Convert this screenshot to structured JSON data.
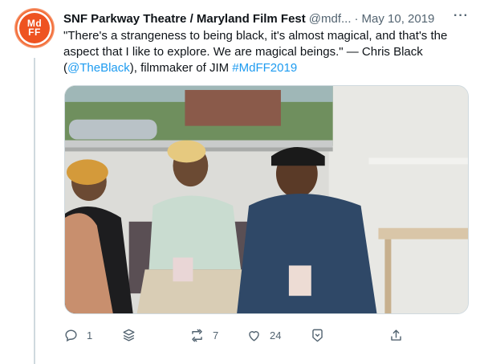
{
  "tweet": {
    "avatar_text_top": "Md",
    "avatar_text_bottom": "FF",
    "author_name": "SNF Parkway Theatre / Maryland Film Fest",
    "handle": "@mdf...",
    "separator": "·",
    "date": "May 10, 2019",
    "more_icon": "···",
    "text_part1": "\"There's a strangeness to being black, it's almost magical, and that's the aspect that I like to explore. We are magical beings.\" — Chris Black (",
    "mention": "@TheBlack",
    "text_part2": "), filmmaker of JIM ",
    "hashtag": "#MdFF2019"
  },
  "actions": {
    "reply_count": "1",
    "retweet_count": "7",
    "like_count": "24"
  },
  "colors": {
    "accent": "#1d9bf0",
    "brand": "#ee5321",
    "muted": "#536471"
  }
}
